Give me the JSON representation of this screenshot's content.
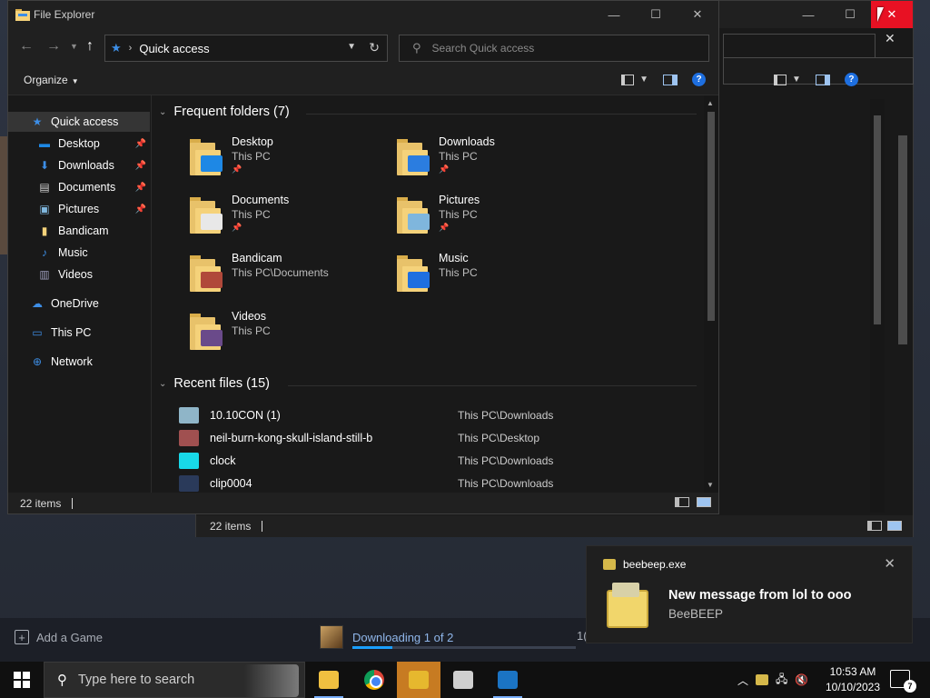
{
  "window": {
    "title": "File Explorer",
    "minimize_glyph": "—",
    "maximize_glyph": "☐",
    "close_glyph": "✕"
  },
  "nav": {
    "address_crumb": "Quick access",
    "search_placeholder": "Search Quick access"
  },
  "command_bar": {
    "organize_label": "Organize"
  },
  "sidebar": {
    "items": [
      {
        "label": "Quick access",
        "icon": "star-icon",
        "pinned": false,
        "selected": true
      },
      {
        "label": "Desktop",
        "icon": "desktop-icon",
        "pinned": true
      },
      {
        "label": "Downloads",
        "icon": "download-icon",
        "pinned": true
      },
      {
        "label": "Documents",
        "icon": "documents-icon",
        "pinned": true
      },
      {
        "label": "Pictures",
        "icon": "pictures-icon",
        "pinned": true
      },
      {
        "label": "Bandicam",
        "icon": "folder-icon",
        "pinned": false
      },
      {
        "label": "Music",
        "icon": "music-icon",
        "pinned": false
      },
      {
        "label": "Videos",
        "icon": "videos-icon",
        "pinned": false
      },
      {
        "label": "OneDrive",
        "icon": "cloud-icon",
        "pinned": false
      },
      {
        "label": "This PC",
        "icon": "computer-icon",
        "pinned": false
      },
      {
        "label": "Network",
        "icon": "network-icon",
        "pinned": false
      }
    ]
  },
  "frequent_folders": {
    "heading": "Frequent folders (7)",
    "items": [
      {
        "name": "Desktop",
        "location": "This PC",
        "pinned": true,
        "overlay_color": "#1e88e5"
      },
      {
        "name": "Downloads",
        "location": "This PC",
        "pinned": true,
        "overlay_color": "#2b7de0"
      },
      {
        "name": "Documents",
        "location": "This PC",
        "pinned": true,
        "overlay_color": "#e8e8e8"
      },
      {
        "name": "Pictures",
        "location": "This PC",
        "pinned": true,
        "overlay_color": "#7fb6dd"
      },
      {
        "name": "Bandicam",
        "location": "This PC\\Documents",
        "pinned": false,
        "overlay_color": "#b0483a"
      },
      {
        "name": "Music",
        "location": "This PC",
        "pinned": false,
        "overlay_color": "#1e6fe0"
      },
      {
        "name": "Videos",
        "location": "This PC",
        "pinned": false,
        "overlay_color": "#6a4a8a"
      }
    ]
  },
  "recent_files": {
    "heading": "Recent files (15)",
    "items": [
      {
        "name": "10.10CON (1)",
        "path": "This PC\\Downloads",
        "icon_color": "#8fb5c8"
      },
      {
        "name": "neil-burn-kong-skull-island-still-b",
        "path": "This PC\\Desktop",
        "icon_color": "#a05050"
      },
      {
        "name": "clock",
        "path": "This PC\\Downloads",
        "icon_color": "#18d8e8"
      },
      {
        "name": "clip0004",
        "path": "This PC\\Downloads",
        "icon_color": "#2a3a5a"
      }
    ]
  },
  "status": {
    "item_count": "22 items"
  },
  "background_window": {
    "item_count": "22 items"
  },
  "steam": {
    "add_game_label": "Add a Game",
    "downloading_label": "Downloading 1 of 2",
    "download_progress": 0.18,
    "download_count_partial": "1("
  },
  "toast": {
    "app_name": "beebeep.exe",
    "title": "New message from lol to ooo",
    "subtitle": "BeeBEEP"
  },
  "taskbar": {
    "search_placeholder": "Type here to search",
    "time": "10:53 AM",
    "date": "10/10/2023",
    "notification_count": "7",
    "apps": [
      {
        "name": "file-explorer-app",
        "color": "#f0c040",
        "active": true
      },
      {
        "name": "chrome-app",
        "active": false
      },
      {
        "name": "beebeep-app",
        "color": "#e6b82e",
        "focus": true
      },
      {
        "name": "eagle-app",
        "color": "#cfcfcf",
        "active": false
      },
      {
        "name": "steam-app",
        "color": "#1b74c4",
        "active": true
      }
    ]
  }
}
